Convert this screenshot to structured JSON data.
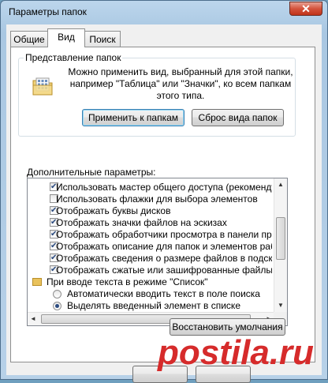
{
  "window": {
    "title": "Параметры папок",
    "close_label": "✕"
  },
  "tabs": [
    {
      "label": "Общие"
    },
    {
      "label": "Вид"
    },
    {
      "label": "Поиск"
    }
  ],
  "folder_view": {
    "group_label": "Представление папок",
    "description": "Можно применить вид, выбранный для этой папки, например \"Таблица\" или \"Значки\", ко всем папкам этого типа.",
    "apply_label": "Применить к папкам",
    "reset_label": "Сброс вида папок"
  },
  "advanced": {
    "label": "Дополнительные параметры:",
    "items": [
      {
        "kind": "checkbox",
        "checked": true,
        "label": "Использовать мастер общего доступа (рекомендует"
      },
      {
        "kind": "checkbox",
        "checked": false,
        "label": "Использовать флажки для выбора элементов"
      },
      {
        "kind": "checkbox",
        "checked": true,
        "label": "Отображать буквы дисков"
      },
      {
        "kind": "checkbox",
        "checked": true,
        "label": "Отображать значки файлов на эскизах"
      },
      {
        "kind": "checkbox",
        "checked": true,
        "label": "Отображать обработчики просмотра в панели просм"
      },
      {
        "kind": "checkbox",
        "checked": true,
        "label": "Отображать описание для папок и элементов рабоче"
      },
      {
        "kind": "checkbox",
        "checked": true,
        "label": "Отображать сведения о размере файлов в подсказк"
      },
      {
        "kind": "checkbox",
        "checked": true,
        "label": "Отображать сжатые или зашифрованные файлы NTI"
      },
      {
        "kind": "folder",
        "label": "При вводе текста в режиме \"Список\""
      },
      {
        "kind": "radio",
        "checked": false,
        "label": "Автоматически вводить текст в поле поиска"
      },
      {
        "kind": "radio",
        "checked": true,
        "label": "Выделять введенный элемент в списке"
      }
    ],
    "scroll_up": "▲",
    "scroll_down": "▼",
    "scroll_left": "◄",
    "scroll_right": "►"
  },
  "restore_defaults_label": "Восстановить умолчания",
  "bottom_buttons": {
    "ok_label": "",
    "cancel_label": ""
  },
  "watermark": {
    "text": "postila.ru",
    "colors": {
      "brand": "#d62b2b"
    }
  }
}
